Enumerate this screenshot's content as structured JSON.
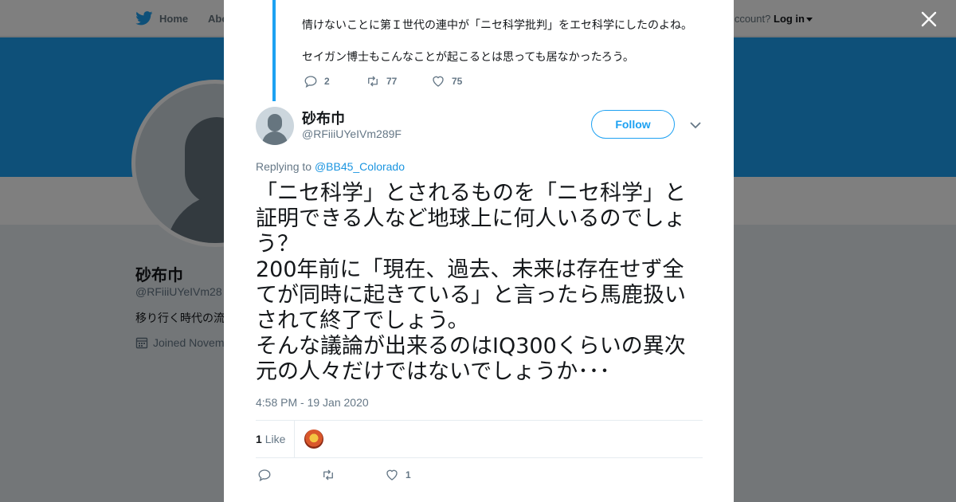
{
  "topbar": {
    "home_label": "Home",
    "about_label": "Abo",
    "account_prompt": "ccount?",
    "login_label": "Log in"
  },
  "background_profile": {
    "name": "砂布巾",
    "handle": "@RFiiiUYeIVm28",
    "bio": "移り行く時代の流",
    "joined": "Joined Novem"
  },
  "previous_tweet": {
    "line1": "情けないことに第Ｉ世代の連中が「ニセ科学批判」をエセ科学にしたのよね。",
    "line2": "セイガン博士もこんなことが起こるとは思っても居なかったろう。",
    "replies": "2",
    "retweets": "77",
    "likes": "75"
  },
  "tweet": {
    "author_name": "砂布巾",
    "author_handle": "@RFiiiUYeIVm289F",
    "follow_label": "Follow",
    "replying_prefix": "Replying to",
    "replying_to": "@BB45_Colorado",
    "text_lines": [
      "「ニセ科学」とされるものを「ニセ科学」と",
      "証明できる人など地球上に何人いるのでしょ",
      "う？",
      "200年前に「現在、過去、未来は存在せず全",
      "てが同時に起きている」と言ったら馬鹿扱い",
      "されて終了でしょう。",
      "そんな議論が出来るのはIQ300くらいの異次",
      "元の人々だけではないでしょうか･･･"
    ],
    "timestamp": "4:58 PM - 19 Jan 2020",
    "like_count": "1",
    "like_label": "Like",
    "action_likes": "1"
  },
  "colors": {
    "accent": "#1da1f2",
    "link": "#1b95e0",
    "secondary_text": "#657786"
  }
}
